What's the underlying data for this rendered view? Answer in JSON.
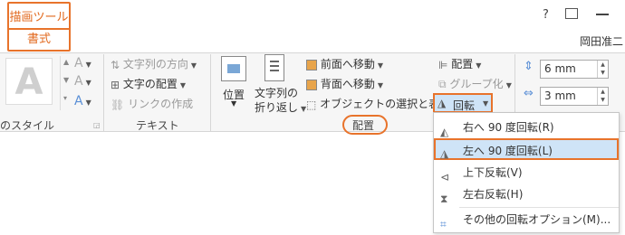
{
  "context_tab": {
    "title": "描画ツール",
    "format": "書式"
  },
  "window": {
    "help": "?",
    "user": "岡田准二"
  },
  "groups": {
    "style_label": "のスタイル",
    "text_label": "テキスト",
    "arrange_label": "配置"
  },
  "text_group": {
    "direction": "文字列の方向",
    "align": "文字の配置",
    "link": "リンクの作成"
  },
  "arrange": {
    "position": "位置",
    "wrap_line1": "文字列の",
    "wrap_line2": "折り返し",
    "bring_forward": "前面へ移動",
    "send_backward": "背面へ移動",
    "selection_pane": "オブジェクトの選択と表示",
    "align": "配置",
    "group": "グループ化",
    "rotate": "回転"
  },
  "size": {
    "height": "6 mm",
    "width": "3 mm"
  },
  "rotate_menu": {
    "items": [
      {
        "label": "右へ 90 度回転(R)",
        "icon": "rotate-right-icon"
      },
      {
        "label": "左へ 90 度回転(L)",
        "icon": "rotate-left-icon"
      },
      {
        "label": "上下反転(V)",
        "icon": "flip-vertical-icon"
      },
      {
        "label": "左右反転(H)",
        "icon": "flip-horizontal-icon"
      },
      {
        "label": "その他の回転オプション(M)...",
        "icon": "rotate-options-icon"
      }
    ]
  },
  "colors": {
    "accent": "#e8732b",
    "highlight": "#cfe4f7"
  }
}
